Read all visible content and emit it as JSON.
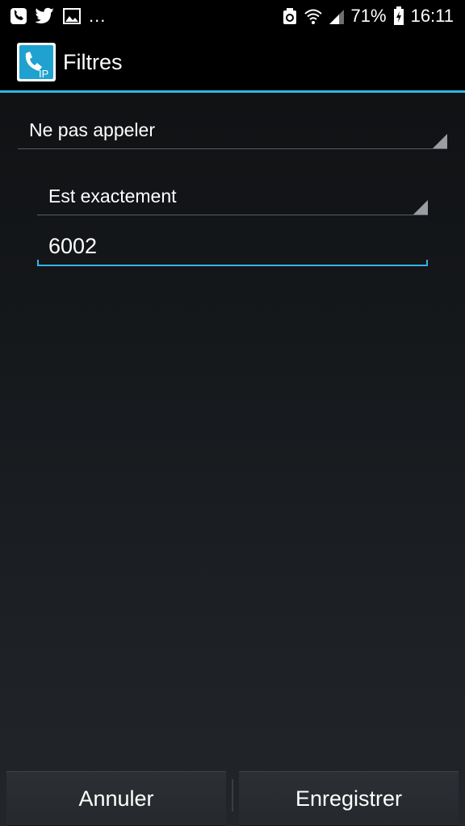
{
  "status_bar": {
    "overflow_dots": "...",
    "battery_percent": "71%",
    "time": "16:11",
    "left_icons": [
      "phone-ip-notification-icon",
      "twitter-icon",
      "gallery-icon"
    ],
    "right_icons": [
      "recycle-icon",
      "wifi-icon",
      "signal-icon",
      "battery-charging-icon"
    ]
  },
  "action_bar": {
    "title": "Filtres",
    "app_icon_label": "IP",
    "accent_color": "#33b5e5"
  },
  "form": {
    "action_spinner": {
      "selected": "Ne pas appeler"
    },
    "match_spinner": {
      "selected": "Est exactement"
    },
    "number_field": {
      "value": "6002"
    }
  },
  "buttons": {
    "cancel_label": "Annuler",
    "save_label": "Enregistrer"
  }
}
